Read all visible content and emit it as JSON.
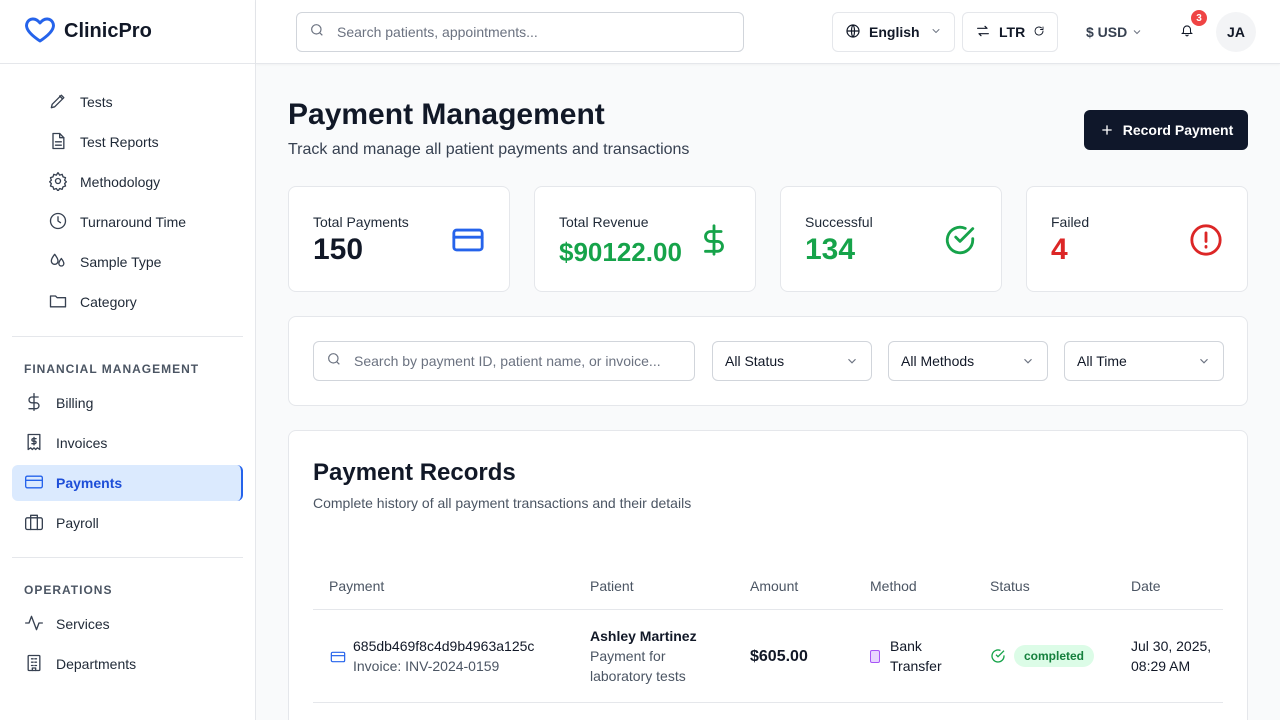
{
  "app": {
    "name": "ClinicPro",
    "brand_color": "#2563eb"
  },
  "sidebar": {
    "lab_items": [
      {
        "label": "Tests",
        "icon": "pencil-icon"
      },
      {
        "label": "Test Reports",
        "icon": "document-icon"
      },
      {
        "label": "Methodology",
        "icon": "gear-icon"
      },
      {
        "label": "Turnaround Time",
        "icon": "clock-icon"
      },
      {
        "label": "Sample Type",
        "icon": "droplets-icon"
      },
      {
        "label": "Category",
        "icon": "folder-icon"
      }
    ],
    "financial_title": "FINANCIAL MANAGEMENT",
    "financial_items": [
      {
        "label": "Billing",
        "icon": "dollar-icon"
      },
      {
        "label": "Invoices",
        "icon": "receipt-icon"
      },
      {
        "label": "Payments",
        "icon": "credit-card-icon",
        "active": true
      },
      {
        "label": "Payroll",
        "icon": "briefcase-icon"
      }
    ],
    "operations_title": "OPERATIONS",
    "operations_items": [
      {
        "label": "Services",
        "icon": "activity-icon"
      },
      {
        "label": "Departments",
        "icon": "building-icon"
      }
    ]
  },
  "topbar": {
    "search_placeholder": "Search patients, appointments...",
    "language": "English",
    "direction": "LTR",
    "currency": "$ USD",
    "notification_count": "3",
    "avatar_initials": "JA"
  },
  "page": {
    "title": "Payment Management",
    "subtitle": "Track and manage all patient payments and transactions",
    "record_button": "Record Payment"
  },
  "stats": [
    {
      "label": "Total Payments",
      "value": "150",
      "color": "#111827",
      "icon": "credit-card-icon",
      "icon_color": "#2563eb"
    },
    {
      "label": "Total Revenue",
      "value": "$90122.00",
      "color": "#16a34a",
      "icon": "dollar-icon",
      "icon_color": "#16a34a"
    },
    {
      "label": "Successful",
      "value": "134",
      "color": "#16a34a",
      "icon": "check-circle-icon",
      "icon_color": "#16a34a"
    },
    {
      "label": "Failed",
      "value": "4",
      "color": "#dc2626",
      "icon": "alert-circle-icon",
      "icon_color": "#dc2626"
    }
  ],
  "filters": {
    "search_placeholder": "Search by payment ID, patient name, or invoice...",
    "status": "All Status",
    "method": "All Methods",
    "time": "All Time"
  },
  "records": {
    "title": "Payment Records",
    "description": "Complete history of all payment transactions and their details",
    "columns": [
      "Payment",
      "Patient",
      "Amount",
      "Method",
      "Status",
      "Date"
    ],
    "rows": [
      {
        "payment_id": "685db469f8c4d9b4963a125c",
        "invoice": "Invoice: INV-2024-0159",
        "patient_name": "Ashley Martinez",
        "patient_note_1": "Payment for",
        "patient_note_2": "laboratory tests",
        "amount": "$605.00",
        "method_1": "Bank",
        "method_2": "Transfer",
        "status": "completed",
        "date_1": "Jul 30, 2025,",
        "date_2": "08:29 AM"
      }
    ]
  }
}
